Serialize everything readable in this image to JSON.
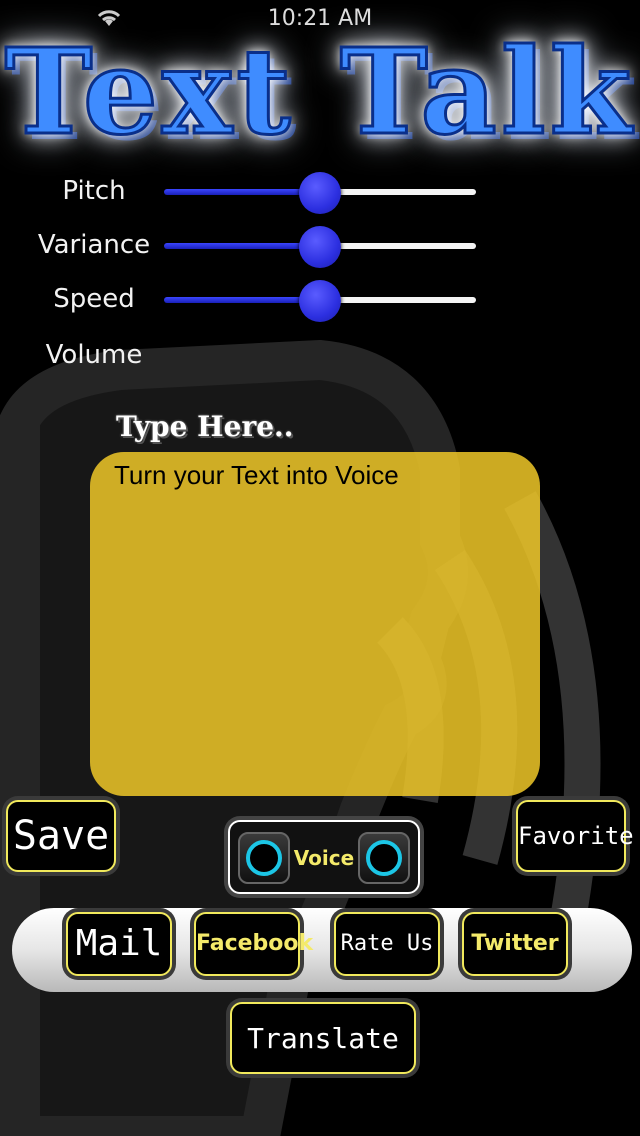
{
  "status_bar": {
    "carrier": "",
    "time": "10:21 AM"
  },
  "app": {
    "title": "Text Talk"
  },
  "sliders": [
    {
      "label": "Pitch",
      "value": 0.5
    },
    {
      "label": "Variance",
      "value": 0.5
    },
    {
      "label": "Speed",
      "value": 0.5
    },
    {
      "label": "Volume",
      "value": null
    }
  ],
  "editor": {
    "label": "Type Here..",
    "text": "Turn your Text into Voice"
  },
  "buttons": {
    "save": "Save",
    "favorite": "Favorite",
    "voice": "Voice",
    "mail": "Mail",
    "facebook": "Facebook",
    "rate_us": "Rate Us",
    "twitter": "Twitter",
    "translate": "Translate"
  },
  "colors": {
    "accent_blue": "#3f8cff",
    "slider_min": "#2c2fe0",
    "text_area": "#f0c828",
    "button_border": "#f1e95c",
    "voice_ring": "#1cc6e6"
  }
}
